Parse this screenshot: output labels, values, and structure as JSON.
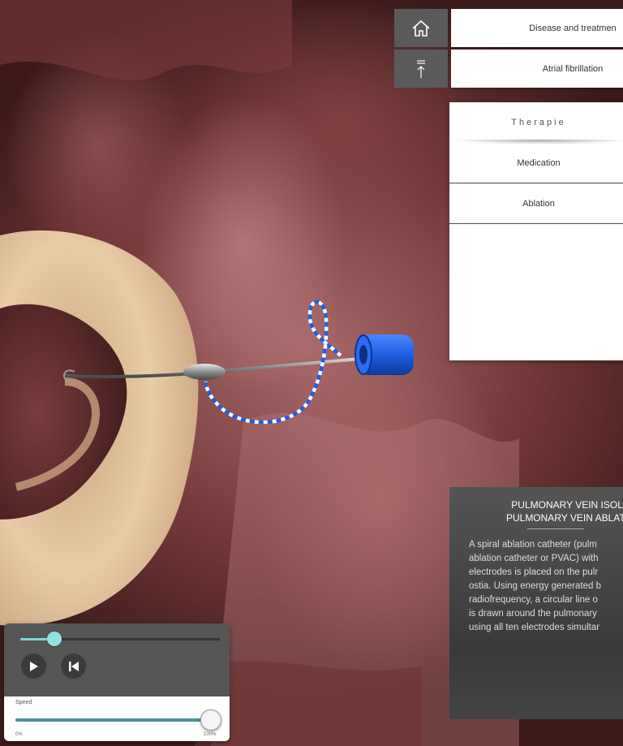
{
  "nav": {
    "home_icon": "home-icon",
    "back_to_top_icon": "scroll-top-icon",
    "disease_label": "Disease and treatmen",
    "atrial_label": "Atrial fibrillation"
  },
  "therapy": {
    "title": "Therapie",
    "items": [
      {
        "label": "Medication"
      },
      {
        "label": "Ablation"
      }
    ]
  },
  "info": {
    "title_line1": "PULMONARY VEIN ISOLATI",
    "title_line2": "PULMONARY VEIN ABLATION",
    "body_lines": [
      "A spiral ablation catheter (pulm",
      "ablation catheter or PVAC) with",
      "electrodes is placed on the pulr",
      "ostia. Using energy generated b",
      "radiofrequency, a circular line o",
      "is drawn around the pulmonary",
      "using all ten electrodes simultar"
    ]
  },
  "player": {
    "timeline_progress": 0.17,
    "play_icon": "play-icon",
    "restart_icon": "skip-back-icon",
    "speed_label": "Speed",
    "speed_value": 1.0,
    "speed_min_label": "0%",
    "speed_max_label": "100%"
  },
  "colors": {
    "accent": "#8ee3e0",
    "panel_dark": "#555555",
    "catheter_blue": "#1f5fe0"
  }
}
